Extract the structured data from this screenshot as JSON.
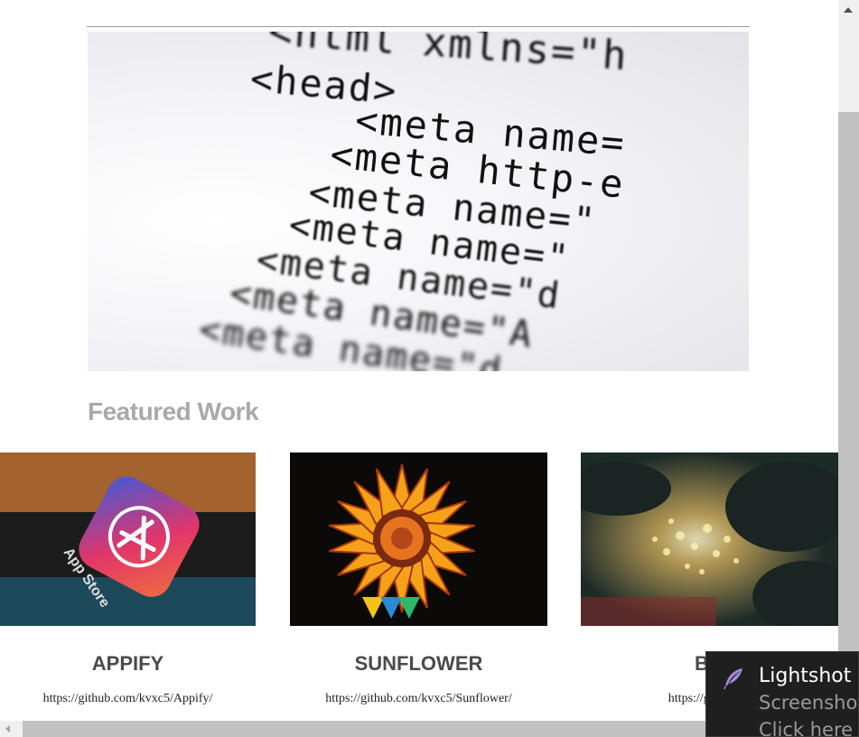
{
  "hero": {
    "code_lines": [
      "<html xmlns=\"h",
      "<head>",
      "<meta name=",
      "<meta http-e",
      "<meta name=\"",
      "<meta name=\"",
      "<meta name=\"d",
      "<meta name=\"A",
      "<meta name=\"d"
    ]
  },
  "section": {
    "title": "Featured Work"
  },
  "projects": [
    {
      "title": "APPIFY",
      "link": "https://github.com/kvxc5/Appify/",
      "image": "app-store-icon"
    },
    {
      "title": "SUNFLOWER",
      "link": "https://github.com/kvxc5/Sunflower/",
      "image": "sunflower"
    },
    {
      "title": "BO",
      "link": "https://github.co",
      "image": "bokeh-lights"
    }
  ],
  "notification": {
    "title": "Lightshot",
    "line1": "Screenshot",
    "line2": "Click here t",
    "icon": "feather-icon"
  },
  "colors": {
    "section_title": "#a9a9a9",
    "card_title": "#4a4a4a",
    "toast_bg": "#1f1f1f"
  }
}
